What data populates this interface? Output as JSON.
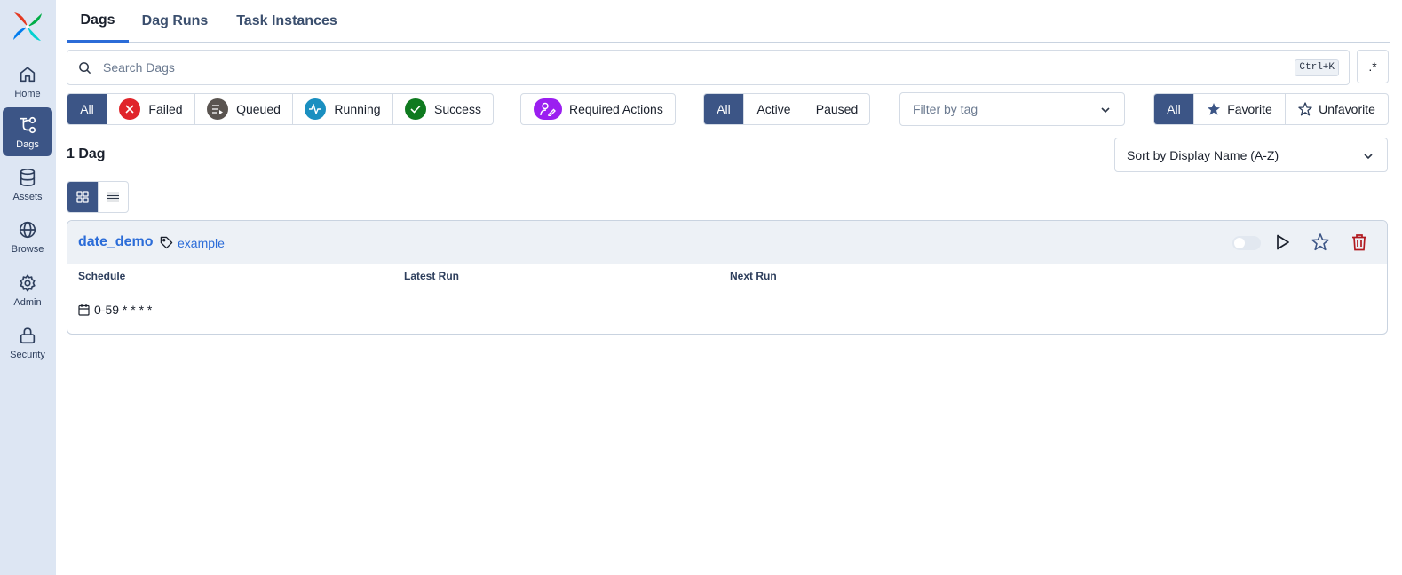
{
  "sidebar": {
    "items": [
      {
        "label": "Home",
        "icon": "home-icon"
      },
      {
        "label": "Dags",
        "icon": "dags-icon",
        "active": true
      },
      {
        "label": "Assets",
        "icon": "database-icon"
      },
      {
        "label": "Browse",
        "icon": "globe-icon"
      },
      {
        "label": "Admin",
        "icon": "gear-icon"
      },
      {
        "label": "Security",
        "icon": "lock-icon"
      }
    ]
  },
  "tabs": [
    {
      "label": "Dags",
      "active": true
    },
    {
      "label": "Dag Runs"
    },
    {
      "label": "Task Instances"
    }
  ],
  "search": {
    "placeholder": "Search Dags",
    "value": "",
    "shortcut": "Ctrl+K",
    "regex_label": ".*"
  },
  "state_filter": {
    "all": "All",
    "failed": "Failed",
    "queued": "Queued",
    "running": "Running",
    "success": "Success"
  },
  "required_actions": "Required Actions",
  "active_filter": {
    "all": "All",
    "active": "Active",
    "paused": "Paused"
  },
  "tag_filter": {
    "placeholder": "Filter by tag"
  },
  "favorite_filter": {
    "all": "All",
    "favorite": "Favorite",
    "unfavorite": "Unfavorite"
  },
  "dag_count": "1 Dag",
  "sort": {
    "selected": "Sort by Display Name (A-Z)"
  },
  "colors": {
    "accent": "#3c5586",
    "link": "#2b6cd8",
    "failed": "#e0252b",
    "queued": "#5a5450",
    "running": "#1a8fc0",
    "success": "#0f7a1f",
    "required": "#9b1ff0",
    "delete": "#b1191f"
  },
  "dags": [
    {
      "name": "date_demo",
      "tag": "example",
      "columns": {
        "schedule": "Schedule",
        "latest_run": "Latest Run",
        "next_run": "Next Run"
      },
      "schedule": "0-59 * * * *"
    }
  ]
}
